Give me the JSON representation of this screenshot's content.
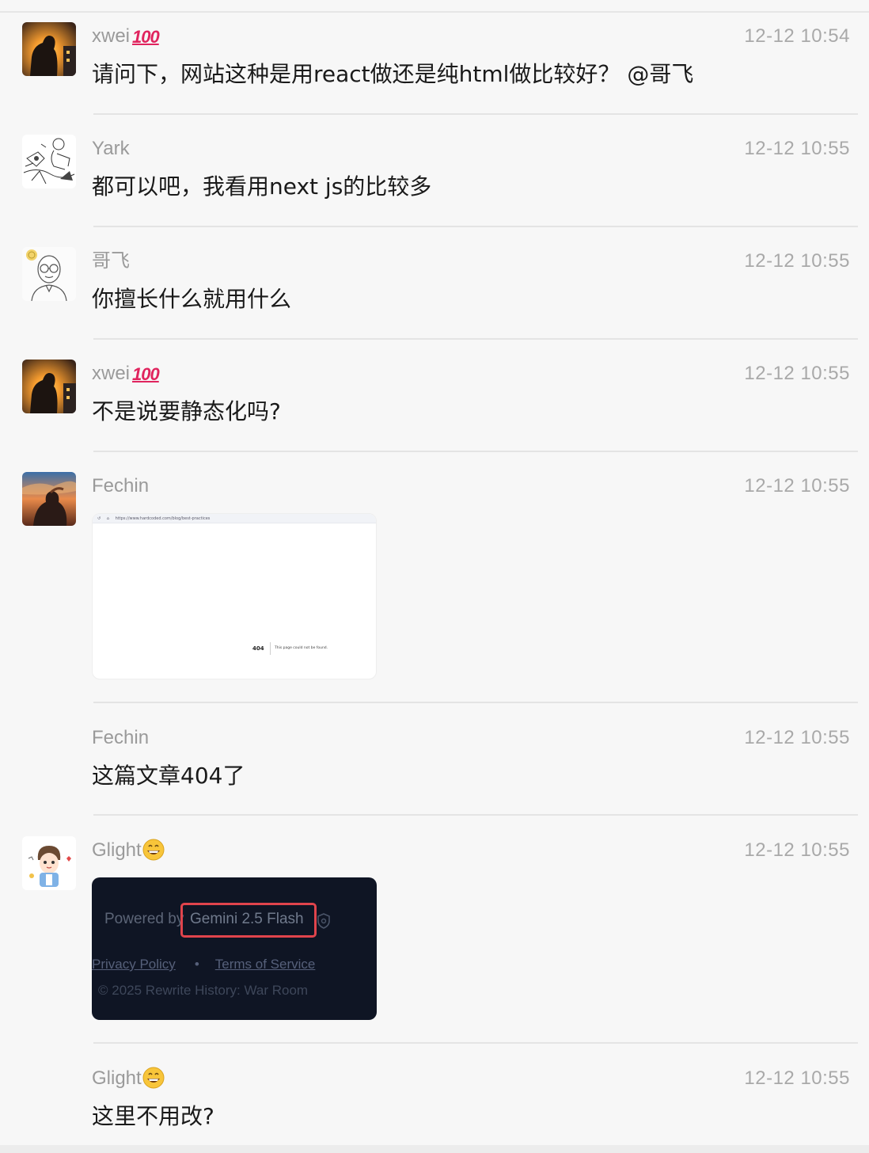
{
  "messages": [
    {
      "name": "xwei",
      "name_emoji": "💯",
      "time": "12-12 10:54",
      "text": "请问下，网站这种是用react做还是纯html做比较好？ @哥飞",
      "avatar_icon": "sunset-silhouette-avatar"
    },
    {
      "name": "Yark",
      "time": "12-12 10:55",
      "text": "都可以吧，我看用next js的比较多",
      "avatar_icon": "sketch-drawing-avatar"
    },
    {
      "name": "哥飞",
      "time": "12-12 10:55",
      "text": "你擅长什么就用什么",
      "avatar_icon": "glasses-man-avatar"
    },
    {
      "name": "xwei",
      "name_emoji": "💯",
      "time": "12-12 10:55",
      "text": "不是说要静态化吗?",
      "avatar_icon": "sunset-silhouette-avatar"
    },
    {
      "name": "Fechin",
      "time": "12-12 10:55",
      "avatar_icon": "sunset-portrait-avatar",
      "image": {
        "url_text": "https://www.hardcoded.com/blog/best-practices",
        "error_code": "404",
        "error_text": "This page could not be found."
      }
    },
    {
      "name": "Fechin",
      "time": "12-12 10:55",
      "text": "这篇文章404了"
    },
    {
      "name": "Glight",
      "name_emoji": "😄",
      "time": "12-12 10:55",
      "avatar_icon": "cartoon-boy-avatar",
      "image": {
        "powered_by": "Powered by",
        "model": "Gemini 2.5 Flash",
        "privacy_link": "Privacy Policy",
        "separator": "•",
        "terms_link": "Terms of Service",
        "copyright": "© 2025 Rewrite History: War Room"
      }
    },
    {
      "name": "Glight",
      "name_emoji": "😄",
      "time": "12-12 10:55",
      "text": "这里不用改?"
    }
  ],
  "colors": {
    "background": "#f7f7f7",
    "name": "#9a9a9a",
    "time": "#a9a9a9",
    "text": "#1a1a1a",
    "divider": "#e4e4e4",
    "highlight": "#e0444c"
  }
}
